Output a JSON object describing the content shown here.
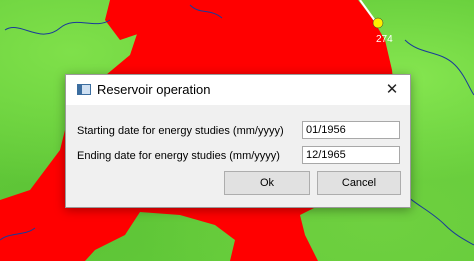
{
  "map": {
    "station_label": "274",
    "colors": {
      "terrain": "#64cc3a",
      "reservoir": "#ff0000",
      "river": "#1a3a9a",
      "station_marker": "#ffee00"
    }
  },
  "dialog": {
    "title": "Reservoir operation",
    "close_symbol": "✕",
    "start_date_label": "Starting date for energy studies (mm/yyyy)",
    "start_date_value": "01/1956",
    "end_date_label": "Ending date for energy studies (mm/yyyy)",
    "end_date_value": "12/1965",
    "ok_label": "Ok",
    "cancel_label": "Cancel"
  }
}
